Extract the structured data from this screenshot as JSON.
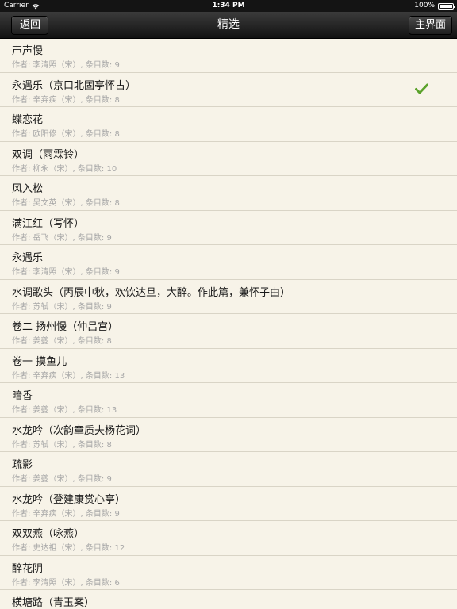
{
  "status_bar": {
    "carrier": "Carrier",
    "time": "1:34 PM",
    "battery": "100%"
  },
  "nav": {
    "back_label": "返回",
    "title": "精选",
    "main_label": "主界面"
  },
  "colors": {
    "background": "#f7f3e8",
    "check": "#5ba22b",
    "nav": "#1e1e1e"
  },
  "items": [
    {
      "title": "声声慢",
      "subtitle": "作者: 李清照（宋）, 条目数: 9",
      "selected": false
    },
    {
      "title": "永遇乐（京口北固亭怀古）",
      "subtitle": "作者: 辛弃疾（宋）, 条目数: 8",
      "selected": true
    },
    {
      "title": "蝶恋花",
      "subtitle": "作者: 欧阳修（宋）, 条目数: 8",
      "selected": false
    },
    {
      "title": "双调（雨霖铃）",
      "subtitle": "作者: 柳永（宋）, 条目数: 10",
      "selected": false
    },
    {
      "title": "风入松",
      "subtitle": "作者: 吴文英（宋）, 条目数: 8",
      "selected": false
    },
    {
      "title": "满江红（写怀）",
      "subtitle": "作者: 岳飞（宋）, 条目数: 9",
      "selected": false
    },
    {
      "title": "永遇乐",
      "subtitle": "作者: 李清照（宋）, 条目数: 9",
      "selected": false
    },
    {
      "title": "水调歌头（丙辰中秋，欢饮达旦，大醉。作此篇，兼怀子由）",
      "subtitle": "作者: 苏轼（宋）, 条目数: 9",
      "selected": false
    },
    {
      "title": "卷二 扬州慢（仲吕宫）",
      "subtitle": "作者: 姜夔（宋）, 条目数: 8",
      "selected": false
    },
    {
      "title": "卷一 摸鱼儿",
      "subtitle": "作者: 辛弃疾（宋）, 条目数: 13",
      "selected": false
    },
    {
      "title": "暗香",
      "subtitle": "作者: 姜夔（宋）, 条目数: 13",
      "selected": false
    },
    {
      "title": "水龙吟（次韵章质夫杨花词）",
      "subtitle": "作者: 苏轼（宋）, 条目数: 8",
      "selected": false
    },
    {
      "title": "疏影",
      "subtitle": "作者: 姜夔（宋）, 条目数: 9",
      "selected": false
    },
    {
      "title": "水龙吟（登建康赏心亭）",
      "subtitle": "作者: 辛弃疾（宋）, 条目数: 9",
      "selected": false
    },
    {
      "title": "双双燕（咏燕）",
      "subtitle": "作者: 史达祖（宋）, 条目数: 12",
      "selected": false
    },
    {
      "title": "醉花阴",
      "subtitle": "作者: 李清照（宋）, 条目数: 6",
      "selected": false
    },
    {
      "title": "横塘路（青玉案）",
      "subtitle": "",
      "selected": false
    }
  ]
}
